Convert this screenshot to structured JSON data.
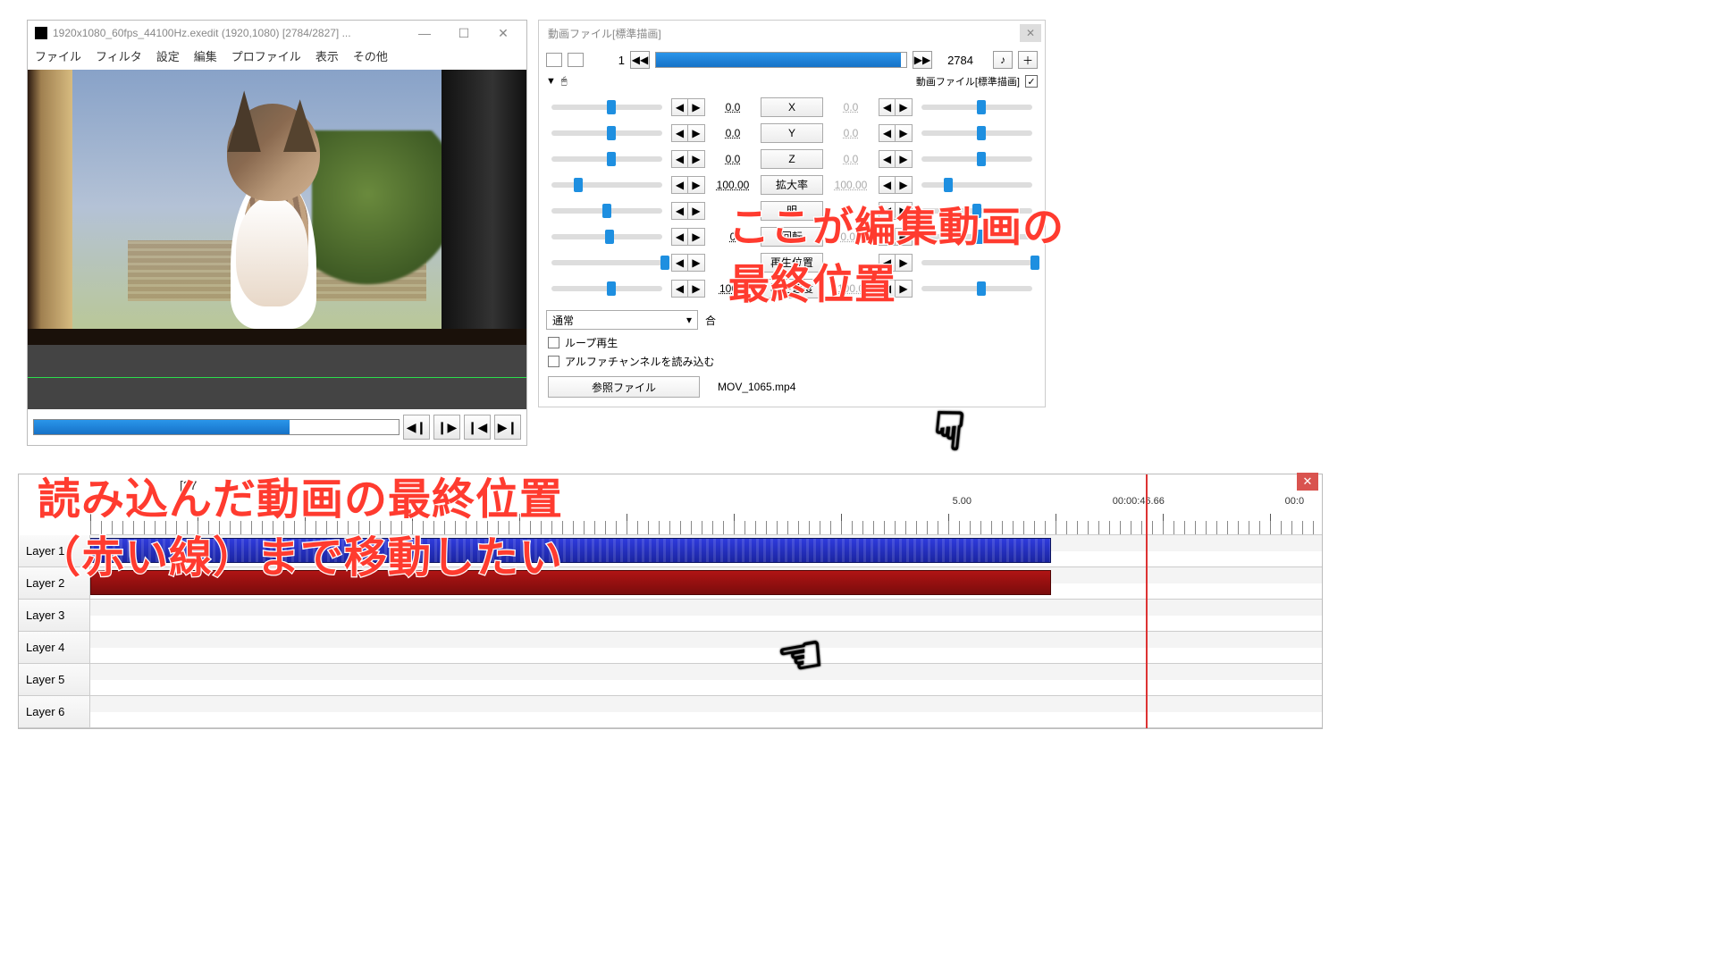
{
  "preview": {
    "title": "1920x1080_60fps_44100Hz.exedit (1920,1080)  [2784/2827] ...",
    "menu": {
      "file": "ファイル",
      "filter": "フィルタ",
      "settings": "設定",
      "edit": "編集",
      "profile": "プロファイル",
      "view": "表示",
      "other": "その他"
    },
    "progress_pct": 70,
    "transport": {
      "prev": "◀❙",
      "next": "❙▶",
      "first": "❙◀",
      "last": "▶❙"
    }
  },
  "prop": {
    "title": "動画ファイル[標準描画]",
    "frame": {
      "num": "1",
      "seekL": "◀◀",
      "seekR": "▶▶",
      "end": "2784",
      "extra1": "♪",
      "extra2": "＋"
    },
    "header2": {
      "dropdown": "▼",
      "mouse": "🖱",
      "label": "動画ファイル[標準描画]",
      "checked": "✓"
    },
    "rows": [
      {
        "v": "0.0",
        "label": "X",
        "v2": "0.0",
        "dim": true,
        "pos": 50
      },
      {
        "v": "0.0",
        "label": "Y",
        "v2": "0.0",
        "dim": true,
        "pos": 50
      },
      {
        "v": "0.0",
        "label": "Z",
        "v2": "0.0",
        "dim": true,
        "pos": 50
      },
      {
        "v": "100.00",
        "label": "拡大率",
        "v2": "100.00",
        "dim": true,
        "pos": 20
      },
      {
        "v": "",
        "label": "明",
        "v2": "",
        "dim": true,
        "pos": 46
      },
      {
        "v": "0",
        "label": "回転",
        "v2": "0.00",
        "dim": true,
        "pos": 48
      },
      {
        "v": "",
        "label": "再生位置",
        "v2": "",
        "dim": true,
        "pos": 98
      },
      {
        "v": "100.0",
        "label": "再生速度",
        "v2": "100.0",
        "dim": true,
        "pos": 50
      }
    ],
    "combo": {
      "value": "通常",
      "arrow": "▾",
      "label_right": "合"
    },
    "chk1": "ループ再生",
    "chk2": "アルファチャンネルを読み込む",
    "ref_btn": "参照ファイル",
    "ref_val": "MOV_1065.mp4"
  },
  "tl": {
    "truncated_frame": "[27",
    "ticks": [
      "5.00",
      "00:00:46.66",
      "00:0"
    ],
    "layers": [
      "Layer 1",
      "Layer 2",
      "Layer 3",
      "Layer 4",
      "Layer 5",
      "Layer 6"
    ]
  },
  "anno": {
    "a1_l1": "ここが編集動画の",
    "a1_l2": "最終位置",
    "a2_l1": "読み込んだ動画の最終位置",
    "a2_l2": "（赤い線）まで移動したい"
  }
}
